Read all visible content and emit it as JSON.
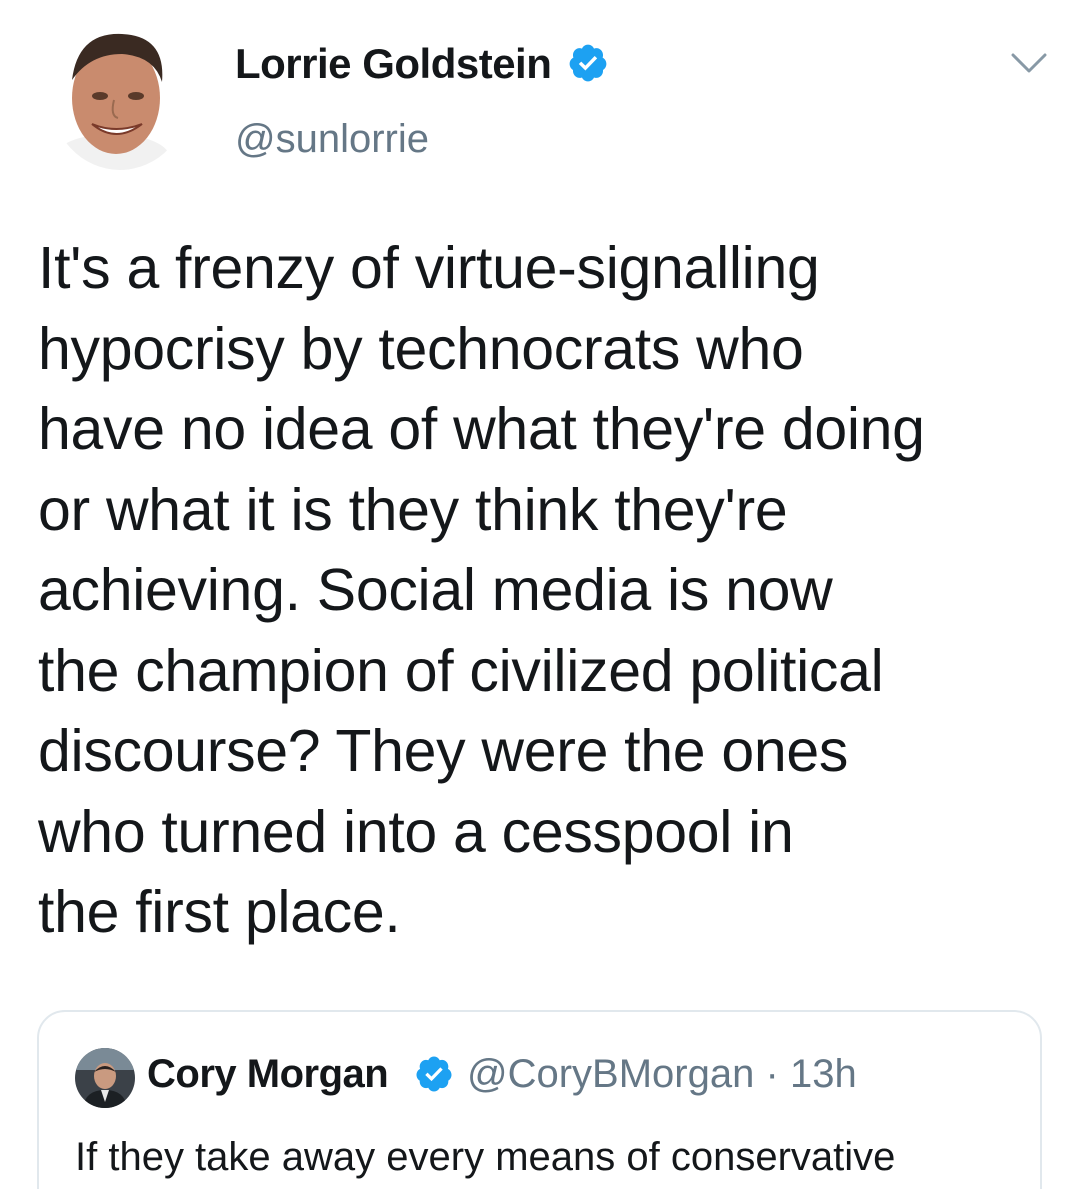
{
  "author": {
    "name": "Lorrie Goldstein",
    "handle": "@sunlorrie",
    "verified": true
  },
  "icons": {
    "menu": "chevron-down-icon",
    "verified": "verified-badge-icon"
  },
  "tweet": {
    "text": "It's a frenzy of virtue-signalling\nhypocrisy by technocrats who\nhave no idea of what they're doing\nor what it is they think they're\nachieving. Social media is now\nthe champion of civilized political\ndiscourse? They were the ones\nwho turned into a cesspool in\nthe first place."
  },
  "quoted": {
    "name": "Cory Morgan",
    "handle": "@CoryBMorgan",
    "separator": "·",
    "time": "13h",
    "text": "If they take away every means of conservative"
  },
  "colors": {
    "text": "#14171a",
    "secondary": "#657786",
    "verified": "#1da1f2",
    "border": "#e1e8ed"
  }
}
